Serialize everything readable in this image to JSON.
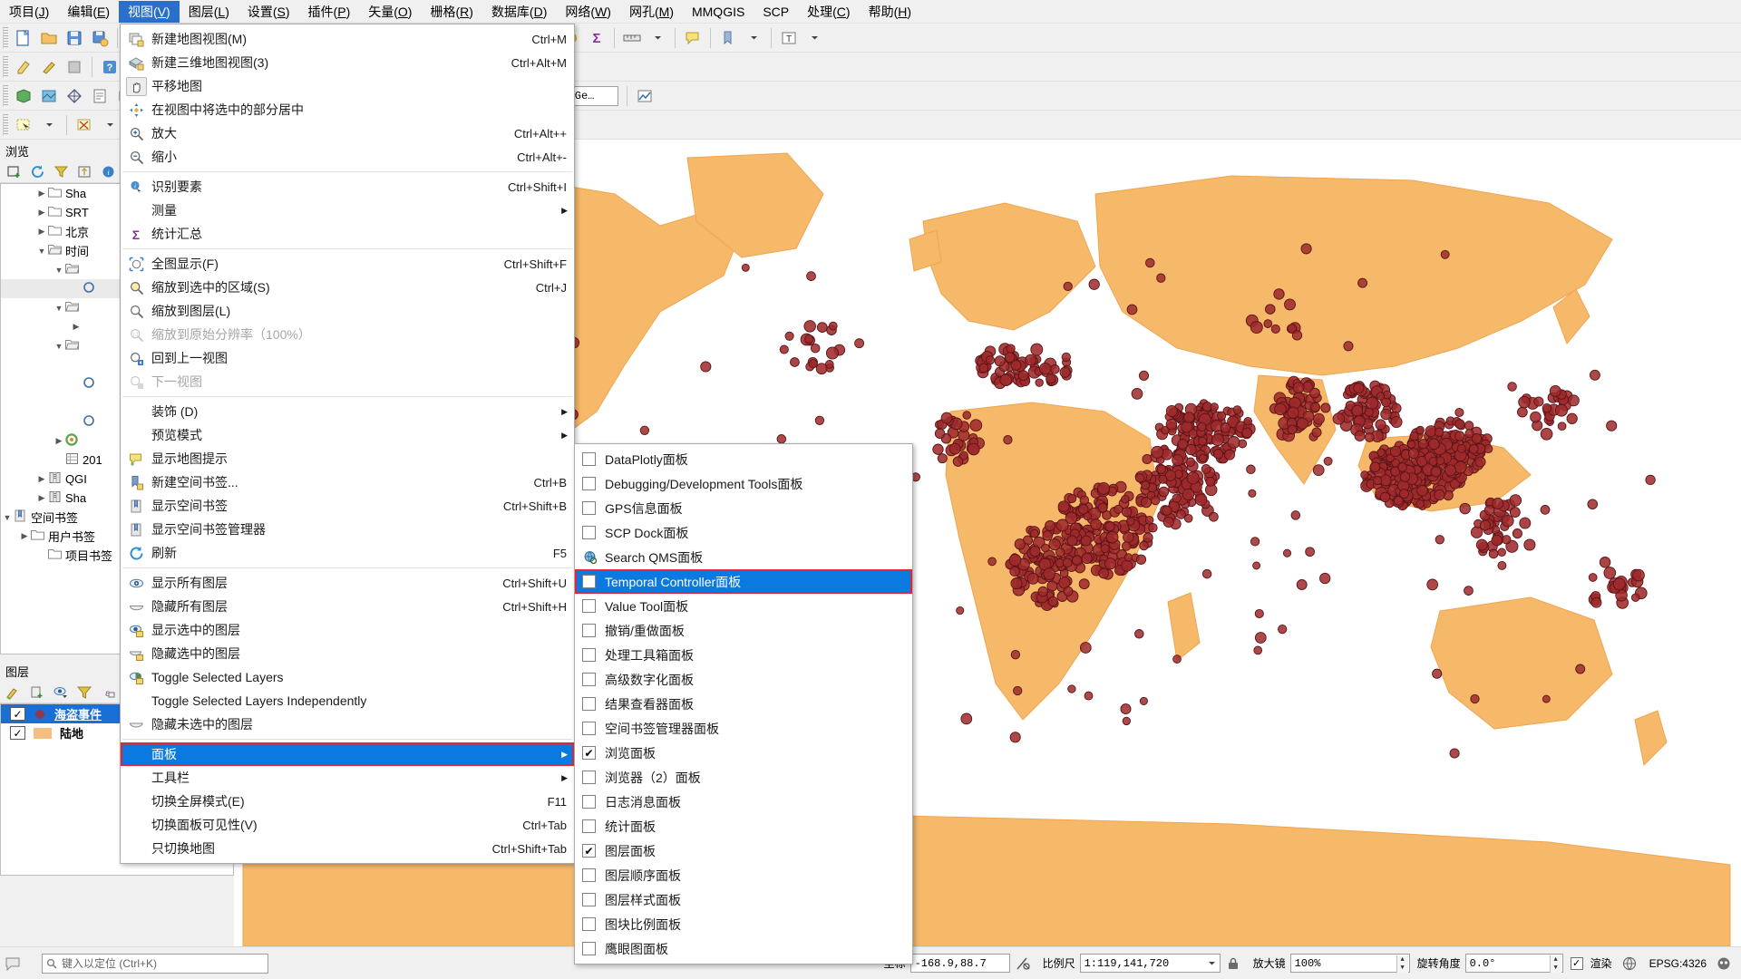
{
  "menubar": {
    "items": [
      {
        "label": "项目(J)",
        "mnemonic": "J",
        "active": false
      },
      {
        "label": "编辑(E)",
        "mnemonic": "E",
        "active": false
      },
      {
        "label": "视图(V)",
        "mnemonic": "V",
        "active": true
      },
      {
        "label": "图层(L)",
        "mnemonic": "L",
        "active": false
      },
      {
        "label": "设置(S)",
        "mnemonic": "S",
        "active": false
      },
      {
        "label": "插件(P)",
        "mnemonic": "P",
        "active": false
      },
      {
        "label": "矢量(O)",
        "mnemonic": "O",
        "active": false
      },
      {
        "label": "栅格(R)",
        "mnemonic": "R",
        "active": false
      },
      {
        "label": "数据库(D)",
        "mnemonic": "D",
        "active": false
      },
      {
        "label": "网络(W)",
        "mnemonic": "W",
        "active": false
      },
      {
        "label": "网孔(M)",
        "mnemonic": "M",
        "active": false
      },
      {
        "label": "MMQGIS",
        "mnemonic": "",
        "active": false
      },
      {
        "label": "SCP",
        "mnemonic": "",
        "active": false
      },
      {
        "label": "处理(C)",
        "mnemonic": "C",
        "active": false
      },
      {
        "label": "帮助(H)",
        "mnemonic": "H",
        "active": false
      }
    ]
  },
  "toolbars": {
    "projection_combo": "MapTiler Ge…"
  },
  "view_menu": {
    "items": [
      {
        "label": "新建地图视图(M)",
        "shortcut": "Ctrl+M",
        "icon": "new-map-view-icon",
        "disabled": false
      },
      {
        "label": "新建三维地图视图(3)",
        "shortcut": "Ctrl+Alt+M",
        "icon": "new-3d-map-view-icon",
        "disabled": false
      },
      {
        "label": "平移地图",
        "shortcut": "",
        "icon": "pan-hand-icon",
        "disabled": false,
        "pressed": true
      },
      {
        "label": "在视图中将选中的部分居中",
        "shortcut": "",
        "icon": "center-selection-icon",
        "disabled": false
      },
      {
        "label": "放大",
        "shortcut": "Ctrl+Alt++",
        "icon": "zoom-in-icon",
        "disabled": false
      },
      {
        "label": "缩小",
        "shortcut": "Ctrl+Alt+-",
        "icon": "zoom-out-icon",
        "disabled": false
      },
      {
        "separator": true
      },
      {
        "label": "识别要素",
        "shortcut": "Ctrl+Shift+I",
        "icon": "identify-features-icon",
        "disabled": false
      },
      {
        "label": "测量",
        "shortcut": "",
        "icon": "",
        "disabled": false,
        "submenu": true
      },
      {
        "label": "统计汇总",
        "shortcut": "",
        "icon": "sigma-statistics-icon",
        "disabled": false
      },
      {
        "separator": true
      },
      {
        "label": "全图显示(F)",
        "shortcut": "Ctrl+Shift+F",
        "icon": "zoom-full-icon",
        "disabled": false
      },
      {
        "label": "缩放到选中的区域(S)",
        "shortcut": "Ctrl+J",
        "icon": "zoom-to-selection-icon",
        "disabled": false
      },
      {
        "label": "缩放到图层(L)",
        "shortcut": "",
        "icon": "zoom-to-layer-icon",
        "disabled": false
      },
      {
        "label": "缩放到原始分辨率（100%）",
        "shortcut": "",
        "icon": "zoom-native-icon",
        "disabled": true
      },
      {
        "label": "回到上一视图",
        "shortcut": "",
        "icon": "zoom-last-icon",
        "disabled": false
      },
      {
        "label": "下一视图",
        "shortcut": "",
        "icon": "zoom-next-icon",
        "disabled": true
      },
      {
        "separator": true
      },
      {
        "label": "装饰 (D)",
        "shortcut": "",
        "icon": "",
        "disabled": false,
        "submenu": true
      },
      {
        "label": "预览模式",
        "shortcut": "",
        "icon": "",
        "disabled": false,
        "submenu": true
      },
      {
        "label": "显示地图提示",
        "shortcut": "",
        "icon": "map-tips-icon",
        "disabled": false
      },
      {
        "label": "新建空间书签...",
        "shortcut": "Ctrl+B",
        "icon": "new-bookmark-icon",
        "disabled": false
      },
      {
        "label": "显示空间书签",
        "shortcut": "Ctrl+Shift+B",
        "icon": "show-bookmarks-icon",
        "disabled": false
      },
      {
        "label": "显示空间书签管理器",
        "shortcut": "",
        "icon": "bookmark-manager-icon",
        "disabled": false
      },
      {
        "label": "刷新",
        "shortcut": "F5",
        "icon": "refresh-icon",
        "disabled": false
      },
      {
        "separator": true
      },
      {
        "label": "显示所有图层",
        "shortcut": "Ctrl+Shift+U",
        "icon": "show-all-layers-icon",
        "disabled": false
      },
      {
        "label": "隐藏所有图层",
        "shortcut": "Ctrl+Shift+H",
        "icon": "hide-all-layers-icon",
        "disabled": false
      },
      {
        "label": "显示选中的图层",
        "shortcut": "",
        "icon": "show-selected-layers-icon",
        "disabled": false
      },
      {
        "label": "隐藏选中的图层",
        "shortcut": "",
        "icon": "hide-selected-layers-icon",
        "disabled": false
      },
      {
        "label": "Toggle Selected Layers",
        "shortcut": "",
        "icon": "toggle-selected-layers-icon",
        "disabled": false
      },
      {
        "label": "Toggle Selected Layers Independently",
        "shortcut": "",
        "icon": "",
        "disabled": false
      },
      {
        "label": "隐藏未选中的图层",
        "shortcut": "",
        "icon": "hide-deselected-layers-icon",
        "disabled": false
      },
      {
        "separator": true
      },
      {
        "label": "面板",
        "shortcut": "",
        "icon": "",
        "disabled": false,
        "submenu": true,
        "highlighted": true,
        "boxed": true
      },
      {
        "label": "工具栏",
        "shortcut": "",
        "icon": "",
        "disabled": false,
        "submenu": true
      },
      {
        "label": "切换全屏模式(E)",
        "shortcut": "F11",
        "icon": "",
        "disabled": false
      },
      {
        "label": "切换面板可见性(V)",
        "shortcut": "Ctrl+Tab",
        "icon": "",
        "disabled": false
      },
      {
        "label": "只切换地图",
        "shortcut": "Ctrl+Shift+Tab",
        "icon": "",
        "disabled": false
      }
    ]
  },
  "panel_menu": {
    "items": [
      {
        "label": "DataPlotly面板",
        "checked": false,
        "icon": "checkbox"
      },
      {
        "label": "Debugging/Development Tools面板",
        "checked": false,
        "icon": "checkbox"
      },
      {
        "label": "GPS信息面板",
        "checked": false,
        "icon": "checkbox"
      },
      {
        "label": "SCP Dock面板",
        "checked": false,
        "icon": "checkbox"
      },
      {
        "label": "Search QMS面板",
        "checked": false,
        "icon": "globe-search-icon"
      },
      {
        "label": "Temporal Controller面板",
        "checked": false,
        "icon": "checkbox",
        "highlighted": true,
        "boxed": true
      },
      {
        "label": "Value Tool面板",
        "checked": false,
        "icon": "checkbox"
      },
      {
        "label": "撤销/重做面板",
        "checked": false,
        "icon": "checkbox"
      },
      {
        "label": "处理工具箱面板",
        "checked": false,
        "icon": "checkbox"
      },
      {
        "label": "高级数字化面板",
        "checked": false,
        "icon": "checkbox"
      },
      {
        "label": "结果查看器面板",
        "checked": false,
        "icon": "checkbox"
      },
      {
        "label": "空间书签管理器面板",
        "checked": false,
        "icon": "checkbox"
      },
      {
        "label": "浏览面板",
        "checked": true,
        "icon": "checkbox"
      },
      {
        "label": "浏览器（2）面板",
        "checked": false,
        "icon": "checkbox"
      },
      {
        "label": "日志消息面板",
        "checked": false,
        "icon": "checkbox"
      },
      {
        "label": "统计面板",
        "checked": false,
        "icon": "checkbox"
      },
      {
        "label": "图层面板",
        "checked": true,
        "icon": "checkbox"
      },
      {
        "label": "图层顺序面板",
        "checked": false,
        "icon": "checkbox"
      },
      {
        "label": "图层样式面板",
        "checked": false,
        "icon": "checkbox"
      },
      {
        "label": "图块比例面板",
        "checked": false,
        "icon": "checkbox"
      },
      {
        "label": "鹰眼图面板",
        "checked": false,
        "icon": "checkbox"
      }
    ]
  },
  "browser_panel": {
    "title": "浏览",
    "rows": [
      {
        "indent": 2,
        "arrow": "right",
        "icon": "folder",
        "label": "Sha"
      },
      {
        "indent": 2,
        "arrow": "right",
        "icon": "folder",
        "label": "SRT"
      },
      {
        "indent": 2,
        "arrow": "right",
        "icon": "folder",
        "label": "北京"
      },
      {
        "indent": 2,
        "arrow": "down",
        "icon": "folder-open",
        "label": "时间"
      },
      {
        "indent": 3,
        "arrow": "down",
        "icon": "folder-open",
        "label": ""
      },
      {
        "indent": 4,
        "arrow": "",
        "icon": "layer",
        "label": "",
        "selected": "grey"
      },
      {
        "indent": 3,
        "arrow": "down",
        "icon": "folder-open",
        "label": ""
      },
      {
        "indent": 4,
        "arrow": "right",
        "icon": "",
        "label": ""
      },
      {
        "indent": 3,
        "arrow": "down",
        "icon": "folder-open",
        "label": ""
      },
      {
        "indent": 4,
        "arrow": "",
        "icon": "",
        "label": ""
      },
      {
        "indent": 4,
        "arrow": "",
        "icon": "layer",
        "label": ""
      },
      {
        "indent": 4,
        "arrow": "",
        "icon": "",
        "label": ""
      },
      {
        "indent": 4,
        "arrow": "",
        "icon": "layer",
        "label": ""
      },
      {
        "indent": 3,
        "arrow": "right",
        "icon": "qgis",
        "label": ""
      },
      {
        "indent": 3,
        "arrow": "",
        "icon": "table",
        "label": "201"
      },
      {
        "indent": 2,
        "arrow": "right",
        "icon": "zip",
        "label": "QGI"
      },
      {
        "indent": 2,
        "arrow": "right",
        "icon": "zip",
        "label": "Sha"
      },
      {
        "indent": 0,
        "arrow": "down",
        "icon": "bookmark",
        "label": "空间书签"
      },
      {
        "indent": 1,
        "arrow": "right",
        "icon": "folder",
        "label": "用户书签"
      },
      {
        "indent": 2,
        "arrow": "",
        "icon": "folder",
        "label": "项目书签"
      }
    ]
  },
  "layers_panel": {
    "title": "图层",
    "rows": [
      {
        "checked": true,
        "symbol": "circle",
        "symbol_color": "#8e3a4a",
        "label": "海盗事件",
        "selected": true
      },
      {
        "checked": true,
        "symbol": "square",
        "symbol_color": "#f5bd7e",
        "label": "陆地",
        "selected": false
      }
    ]
  },
  "statusbar": {
    "coordinate_label": "坐标",
    "coordinate_value": "-168.9,88.7",
    "scale_label": "比例尺",
    "scale_value": "1:119,141,720",
    "magnifier_label": "放大镜",
    "magnifier_value": "100%",
    "rotation_label": "旋转角度",
    "rotation_value": "0.0°",
    "render_label": "渲染",
    "render_checked": true,
    "crs_value": "EPSG:4326",
    "locator_placeholder": "键入以定位 (Ctrl+K)"
  },
  "map": {
    "land_color": "#f6b96a",
    "land_stroke": "#f0a44f",
    "point_fill": "#9e2a2b",
    "point_stroke": "#5a1417",
    "background": "#ffffff"
  },
  "colors": {
    "accent_blue": "#0a7ae0",
    "menu_active": "#2a6fc9",
    "highlight_red": "#e32636",
    "layer_selected": "#1a6fd4"
  }
}
